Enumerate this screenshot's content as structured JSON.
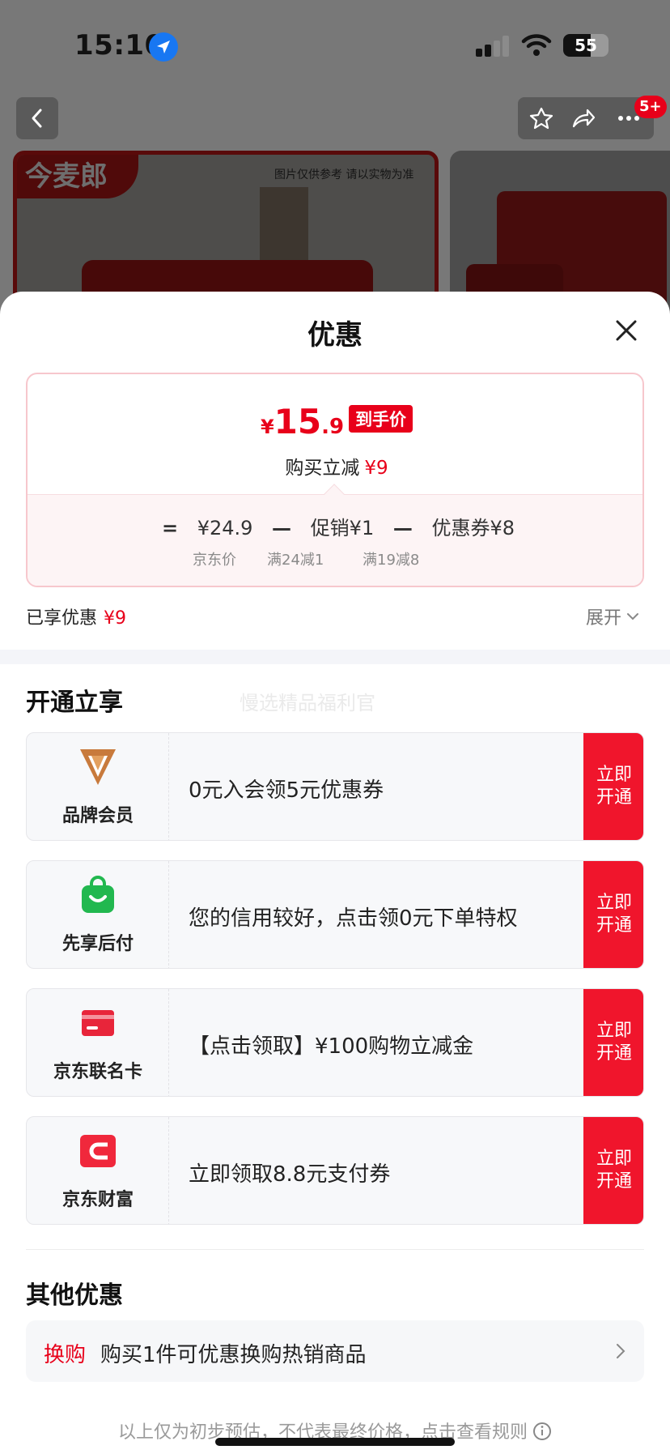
{
  "status_bar": {
    "time": "15:10",
    "battery": "55"
  },
  "product_page": {
    "cart_badge": "5+",
    "brand_logo": "今麦郎",
    "image_note": "图片仅供参考 请以实物为准"
  },
  "sheet": {
    "title": "优惠",
    "price": {
      "currency": "¥",
      "integer": "15",
      "decimal": ".9",
      "tag": "到手价"
    },
    "saving": {
      "label": "购买立减",
      "amount": "¥9"
    },
    "formula": {
      "eq": "=",
      "minus": "—",
      "items": [
        {
          "value": "¥24.9",
          "sub": "京东价"
        },
        {
          "value": "促销¥1",
          "sub": "满24减1"
        },
        {
          "value": "优惠券¥8",
          "sub": "满19减8"
        }
      ]
    },
    "enjoyed": {
      "label": "已享优惠",
      "amount": "¥9"
    },
    "expand_label": "展开",
    "open_section": {
      "title": "开通立享",
      "watermark": "慢选精品福利官",
      "items": [
        {
          "name": "品牌会员",
          "desc": "0元入会领5元优惠券",
          "cta": "立即\n开通",
          "icon": "brand-v-icon"
        },
        {
          "name": "先享后付",
          "desc": "您的信用较好，点击领0元下单特权",
          "cta": "立即\n开通",
          "icon": "shopping-bag-icon"
        },
        {
          "name": "京东联名卡",
          "desc": "【点击领取】¥100购物立减金",
          "cta": "立即\n开通",
          "icon": "credit-card-icon"
        },
        {
          "name": "京东财富",
          "desc": "立即领取8.8元支付券",
          "cta": "立即\n开通",
          "icon": "wallet-icon"
        }
      ]
    },
    "other_section": {
      "title": "其他优惠",
      "items": [
        {
          "tag": "换购",
          "text": "购买1件可优惠换购热销商品"
        }
      ]
    },
    "footer_note": "以上仅为初步预估，不代表最终价格，点击查看规则"
  },
  "colors": {
    "accent": "#e8001a",
    "cta": "#f0152c",
    "card_border": "#f7c7cd"
  }
}
